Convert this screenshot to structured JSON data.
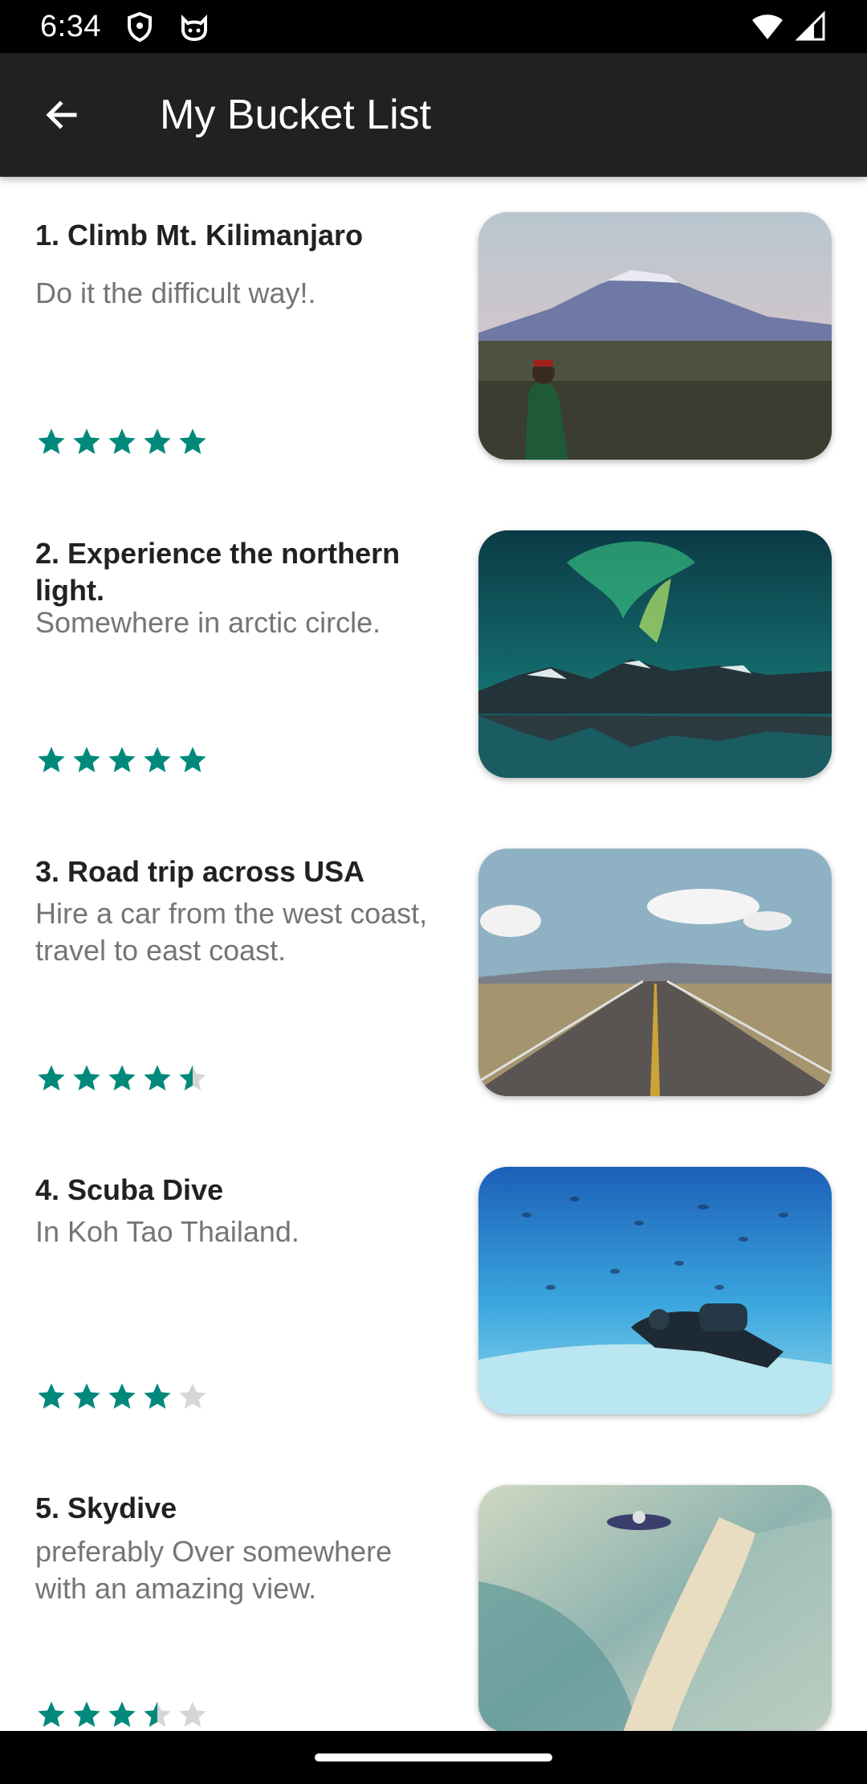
{
  "status_bar": {
    "time": "6:34",
    "icons": [
      "shield-icon",
      "cat-icon",
      "wifi-icon",
      "signal-icon"
    ]
  },
  "app_bar": {
    "title": "My Bucket List",
    "back_icon": "arrow-back-icon"
  },
  "accent_color": "#00897B",
  "empty_star_color": "#D6D6D6",
  "items": [
    {
      "title": "1. Climb Mt. Kilimanjaro",
      "description": "Do it the difficult way!.",
      "rating": 5,
      "image": "mountain-photo"
    },
    {
      "title": "2. Experience the northern light.",
      "description": "Somewhere in arctic circle.",
      "rating": 5,
      "image": "aurora-photo"
    },
    {
      "title": "3. Road trip across USA",
      "description": "Hire a car from the west coast, travel to east coast.",
      "rating": 4.5,
      "image": "road-photo"
    },
    {
      "title": "4. Scuba Dive",
      "description": "In Koh Tao Thailand.",
      "rating": 4,
      "image": "underwater-photo"
    },
    {
      "title": "5. Skydive",
      "description": "preferably Over somewhere with an amazing view.",
      "rating": 3.5,
      "image": "skydive-photo"
    }
  ]
}
